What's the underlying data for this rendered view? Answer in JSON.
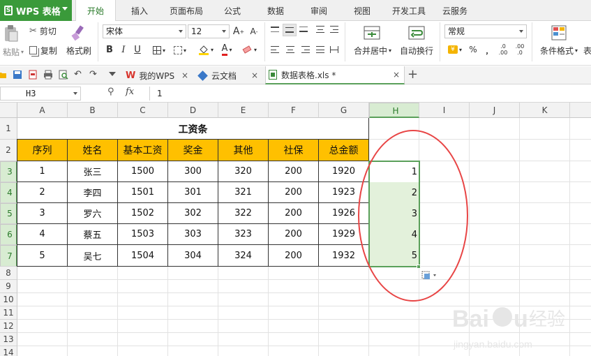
{
  "app": {
    "name": "WPS 表格"
  },
  "menu": {
    "items": [
      {
        "label": "开始",
        "active": true
      },
      {
        "label": "插入"
      },
      {
        "label": "页面布局"
      },
      {
        "label": "公式"
      },
      {
        "label": "数据"
      },
      {
        "label": "审阅"
      },
      {
        "label": "视图"
      },
      {
        "label": "开发工具"
      },
      {
        "label": "云服务"
      }
    ]
  },
  "ribbon": {
    "paste": "粘贴",
    "cut": "剪切",
    "copy": "复制",
    "format_painter": "格式刷",
    "font_name": "宋体",
    "font_size": "12",
    "bold": "B",
    "italic": "I",
    "underline": "U",
    "merge_center": "合并居中",
    "wrap_text": "自动换行",
    "number_format": "常规",
    "percent": "%",
    "comma": "﹐",
    "conditional_format": "条件格式",
    "table_style_partial": "表"
  },
  "doc_tabs": [
    {
      "label": "我的WPS",
      "icon": "wps-icon"
    },
    {
      "label": "云文档",
      "icon": "cloud-doc-icon"
    },
    {
      "label": "数据表格.xls *",
      "icon": "spreadsheet-file-icon",
      "active": true
    }
  ],
  "formula_bar": {
    "cell_ref": "H3",
    "fx": "fx",
    "value": "1"
  },
  "columns": [
    "A",
    "B",
    "C",
    "D",
    "E",
    "F",
    "G",
    "H",
    "I",
    "J",
    "K"
  ],
  "rows": [
    "1",
    "2",
    "3",
    "4",
    "5",
    "6",
    "7",
    "8",
    "9",
    "10",
    "11",
    "12",
    "13",
    "14"
  ],
  "sheet": {
    "title": "工资条",
    "headers": [
      "序列",
      "姓名",
      "基本工资",
      "奖金",
      "其他",
      "社保",
      "总金额"
    ],
    "records": [
      [
        "1",
        "张三",
        "1500",
        "300",
        "320",
        "200",
        "1920"
      ],
      [
        "2",
        "李四",
        "1501",
        "301",
        "321",
        "200",
        "1923"
      ],
      [
        "3",
        "罗六",
        "1502",
        "302",
        "322",
        "200",
        "1926"
      ],
      [
        "4",
        "蔡五",
        "1503",
        "303",
        "323",
        "200",
        "1929"
      ],
      [
        "5",
        "吴七",
        "1504",
        "304",
        "324",
        "200",
        "1932"
      ]
    ],
    "helper_column_h": [
      "1",
      "2",
      "3",
      "4",
      "5"
    ]
  },
  "colors": {
    "accent_green": "#5aa05a",
    "header_fill": "#ffc000",
    "selection_fill": "#e3f1db",
    "annotation_red": "#e84545"
  },
  "watermark": {
    "brand": "Baidu经验",
    "url": "jingyan.baidu.com"
  }
}
